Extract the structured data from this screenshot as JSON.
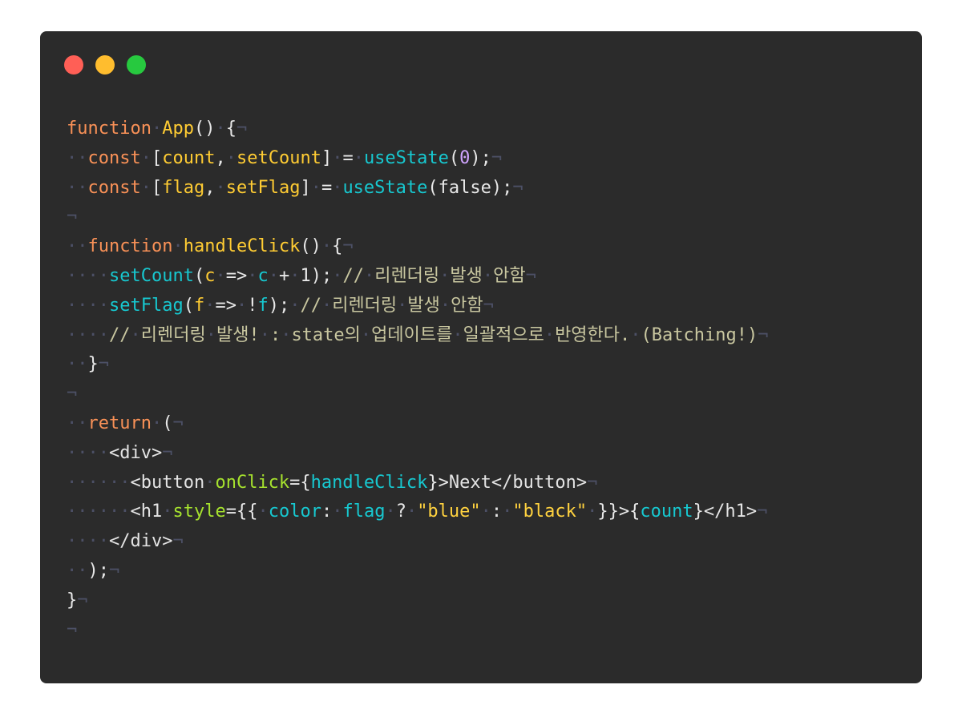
{
  "window": {
    "lights": [
      {
        "name": "close",
        "color": "#ff5f56"
      },
      {
        "name": "minimize",
        "color": "#ffbd2e"
      },
      {
        "name": "zoom",
        "color": "#27c93f"
      }
    ]
  },
  "code": {
    "lines": [
      [
        [
          "kw",
          "function"
        ],
        [
          "ws",
          "·"
        ],
        [
          "fn",
          "App"
        ],
        [
          "pun",
          "()"
        ],
        [
          "ws",
          "·"
        ],
        [
          "pun",
          "{"
        ],
        [
          "ws",
          "¬"
        ]
      ],
      [
        [
          "ws",
          "··"
        ],
        [
          "kw",
          "const"
        ],
        [
          "ws",
          "·"
        ],
        [
          "pun",
          "["
        ],
        [
          "fn",
          "count"
        ],
        [
          "pun",
          ","
        ],
        [
          "ws",
          "·"
        ],
        [
          "fn",
          "setCount"
        ],
        [
          "pun",
          "]"
        ],
        [
          "ws",
          "·"
        ],
        [
          "pun",
          "="
        ],
        [
          "ws",
          "·"
        ],
        [
          "call",
          "useState"
        ],
        [
          "pun",
          "("
        ],
        [
          "num",
          "0"
        ],
        [
          "pun",
          ");"
        ],
        [
          "ws",
          "¬"
        ]
      ],
      [
        [
          "ws",
          "··"
        ],
        [
          "kw",
          "const"
        ],
        [
          "ws",
          "·"
        ],
        [
          "pun",
          "["
        ],
        [
          "fn",
          "flag"
        ],
        [
          "pun",
          ","
        ],
        [
          "ws",
          "·"
        ],
        [
          "fn",
          "setFlag"
        ],
        [
          "pun",
          "]"
        ],
        [
          "ws",
          "·"
        ],
        [
          "pun",
          "="
        ],
        [
          "ws",
          "·"
        ],
        [
          "call",
          "useState"
        ],
        [
          "pun",
          "(false);"
        ],
        [
          "ws",
          "¬"
        ]
      ],
      [
        [
          "ws",
          "¬"
        ]
      ],
      [
        [
          "ws",
          "··"
        ],
        [
          "kw",
          "function"
        ],
        [
          "ws",
          "·"
        ],
        [
          "fn",
          "handleClick"
        ],
        [
          "pun",
          "()"
        ],
        [
          "ws",
          "·"
        ],
        [
          "pun",
          "{"
        ],
        [
          "ws",
          "¬"
        ]
      ],
      [
        [
          "ws",
          "····"
        ],
        [
          "call",
          "setCount"
        ],
        [
          "pun",
          "("
        ],
        [
          "fn",
          "c"
        ],
        [
          "ws",
          "·"
        ],
        [
          "pun",
          "=>"
        ],
        [
          "ws",
          "·"
        ],
        [
          "call",
          "c"
        ],
        [
          "ws",
          "·"
        ],
        [
          "pun",
          "+"
        ],
        [
          "ws",
          "·"
        ],
        [
          "pun",
          "1);"
        ],
        [
          "ws",
          "·"
        ],
        [
          "cmt",
          "//"
        ],
        [
          "ws",
          "·"
        ],
        [
          "cmt",
          "리렌더링"
        ],
        [
          "ws",
          "·"
        ],
        [
          "cmt",
          "발생"
        ],
        [
          "ws",
          "·"
        ],
        [
          "cmt",
          "안함"
        ],
        [
          "ws",
          "¬"
        ]
      ],
      [
        [
          "ws",
          "····"
        ],
        [
          "call",
          "setFlag"
        ],
        [
          "pun",
          "("
        ],
        [
          "fn",
          "f"
        ],
        [
          "ws",
          "·"
        ],
        [
          "pun",
          "=>"
        ],
        [
          "ws",
          "·"
        ],
        [
          "pun",
          "!"
        ],
        [
          "call",
          "f"
        ],
        [
          "pun",
          ");"
        ],
        [
          "ws",
          "·"
        ],
        [
          "cmt",
          "//"
        ],
        [
          "ws",
          "·"
        ],
        [
          "cmt",
          "리렌더링"
        ],
        [
          "ws",
          "·"
        ],
        [
          "cmt",
          "발생"
        ],
        [
          "ws",
          "·"
        ],
        [
          "cmt",
          "안함"
        ],
        [
          "ws",
          "¬"
        ]
      ],
      [
        [
          "ws",
          "····"
        ],
        [
          "cmt",
          "//"
        ],
        [
          "ws",
          "·"
        ],
        [
          "cmt",
          "리렌더링"
        ],
        [
          "ws",
          "·"
        ],
        [
          "cmt",
          "발생!"
        ],
        [
          "ws",
          "·"
        ],
        [
          "cmt",
          ":"
        ],
        [
          "ws",
          "·"
        ],
        [
          "cmt",
          "state의"
        ],
        [
          "ws",
          "·"
        ],
        [
          "cmt",
          "업데이트를"
        ],
        [
          "ws",
          "·"
        ],
        [
          "cmt",
          "일괄적으로"
        ],
        [
          "ws",
          "·"
        ],
        [
          "cmt",
          "반영한다."
        ],
        [
          "ws",
          "·"
        ],
        [
          "cmt",
          "(Batching!)"
        ],
        [
          "ws",
          "¬"
        ]
      ],
      [
        [
          "ws",
          "··"
        ],
        [
          "pun",
          "}"
        ],
        [
          "ws",
          "¬"
        ]
      ],
      [
        [
          "ws",
          "¬"
        ]
      ],
      [
        [
          "ws",
          "··"
        ],
        [
          "kw",
          "return"
        ],
        [
          "ws",
          "·"
        ],
        [
          "pun",
          "("
        ],
        [
          "ws",
          "¬"
        ]
      ],
      [
        [
          "ws",
          "····"
        ],
        [
          "tag",
          "<div>"
        ],
        [
          "ws",
          "¬"
        ]
      ],
      [
        [
          "ws",
          "······"
        ],
        [
          "tag",
          "<button"
        ],
        [
          "ws",
          "·"
        ],
        [
          "attr",
          "onClick"
        ],
        [
          "pun",
          "={"
        ],
        [
          "call",
          "handleClick"
        ],
        [
          "pun",
          "}>"
        ],
        [
          "plain",
          "Next"
        ],
        [
          "tag",
          "</button>"
        ],
        [
          "ws",
          "¬"
        ]
      ],
      [
        [
          "ws",
          "······"
        ],
        [
          "tag",
          "<h1"
        ],
        [
          "ws",
          "·"
        ],
        [
          "attr",
          "style"
        ],
        [
          "pun",
          "={{"
        ],
        [
          "ws",
          "·"
        ],
        [
          "call",
          "color"
        ],
        [
          "pun",
          ":"
        ],
        [
          "ws",
          "·"
        ],
        [
          "call",
          "flag"
        ],
        [
          "ws",
          "·"
        ],
        [
          "pun",
          "?"
        ],
        [
          "ws",
          "·"
        ],
        [
          "str",
          "\"blue\""
        ],
        [
          "ws",
          "·"
        ],
        [
          "pun",
          ":"
        ],
        [
          "ws",
          "·"
        ],
        [
          "str",
          "\"black\""
        ],
        [
          "ws",
          "·"
        ],
        [
          "pun",
          "}}>{"
        ],
        [
          "call",
          "count"
        ],
        [
          "pun",
          "}"
        ],
        [
          "tag",
          "</h1>"
        ],
        [
          "ws",
          "¬"
        ]
      ],
      [
        [
          "ws",
          "····"
        ],
        [
          "tag",
          "</div>"
        ],
        [
          "ws",
          "¬"
        ]
      ],
      [
        [
          "ws",
          "··"
        ],
        [
          "pun",
          ");"
        ],
        [
          "ws",
          "¬"
        ]
      ],
      [
        [
          "pun",
          "}"
        ],
        [
          "ws",
          "¬"
        ]
      ],
      [
        [
          "ws",
          "¬"
        ]
      ]
    ]
  }
}
